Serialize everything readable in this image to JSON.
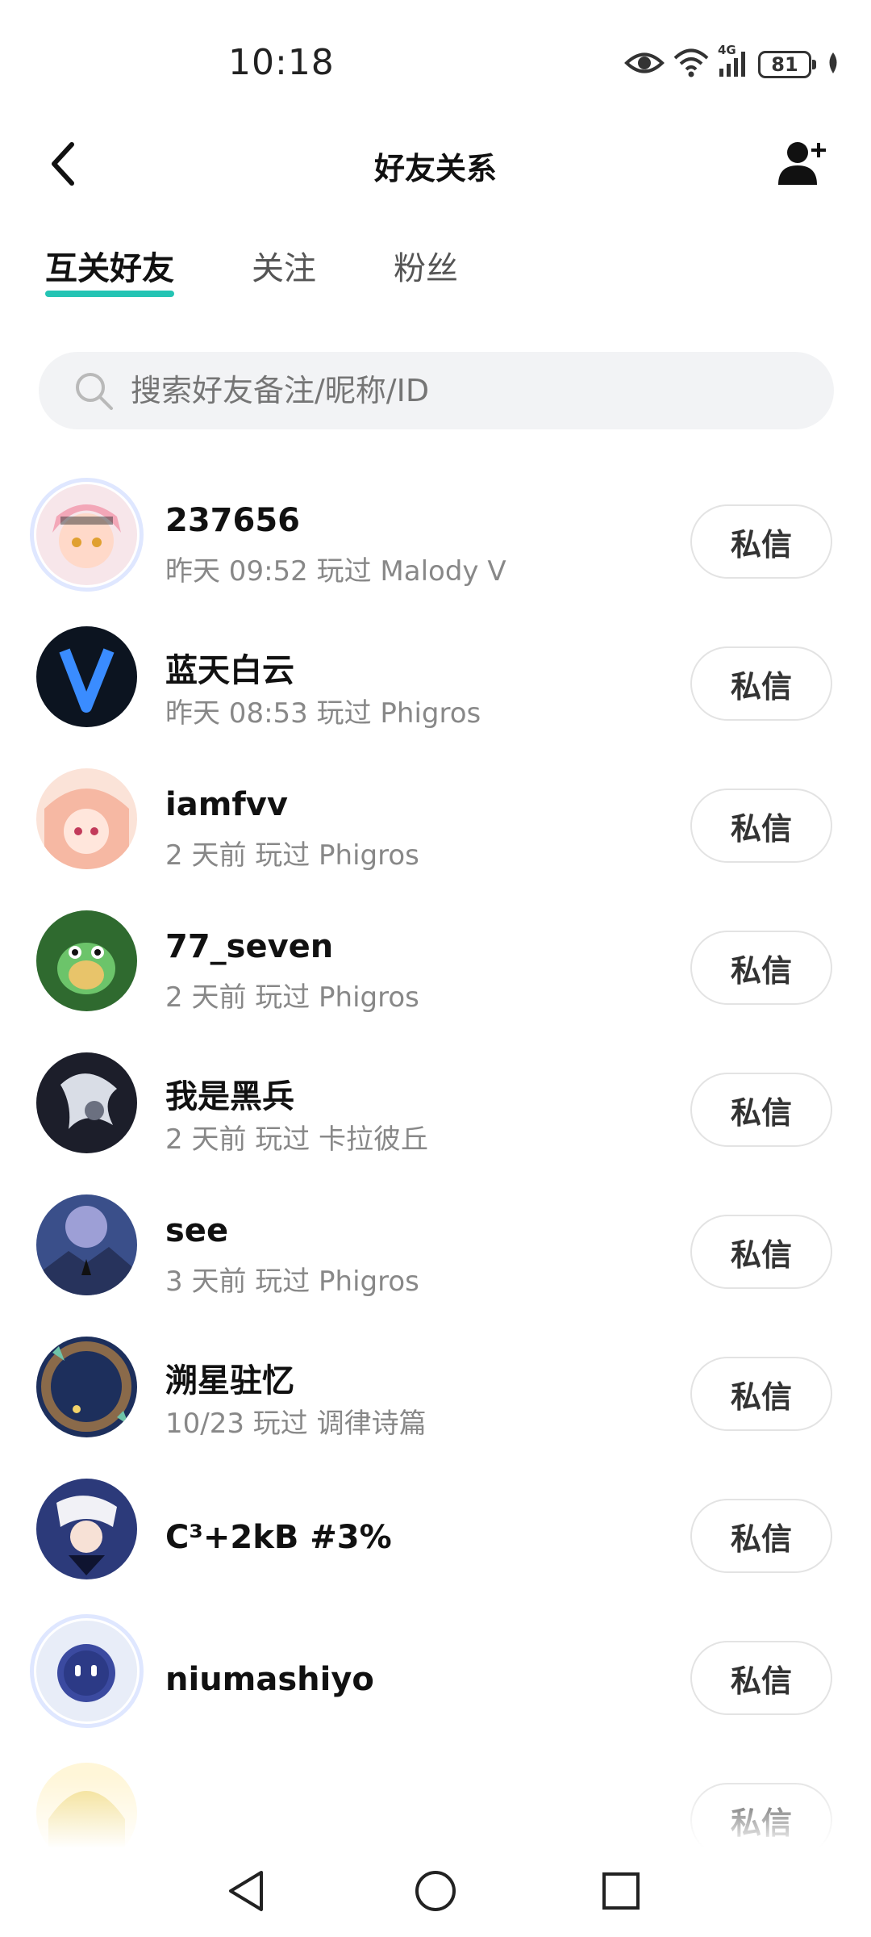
{
  "status_bar": {
    "time": "10:18",
    "network": "4G",
    "battery": "81",
    "icons": [
      "eye-icon",
      "wifi-icon",
      "signal-icon",
      "battery-icon",
      "leaf-icon"
    ]
  },
  "header": {
    "title": "好友关系",
    "back_icon": "chevron-left-icon",
    "add_icon": "add-user-icon"
  },
  "tabs": [
    {
      "label": "互关好友",
      "active": true
    },
    {
      "label": "关注",
      "active": false
    },
    {
      "label": "粉丝",
      "active": false
    }
  ],
  "search": {
    "placeholder": "搜索好友备注/昵称/ID",
    "value": ""
  },
  "friends": [
    {
      "name": "237656",
      "meta": "昨天 09:52 玩过 Malody V",
      "action": "私信"
    },
    {
      "name": "蓝天白云",
      "meta": "昨天 08:53 玩过 Phigros",
      "action": "私信"
    },
    {
      "name": "iamfvv",
      "meta": "2 天前 玩过 Phigros",
      "action": "私信"
    },
    {
      "name": "77_seven",
      "meta": "2 天前 玩过 Phigros",
      "action": "私信"
    },
    {
      "name": "我是黑兵",
      "meta": "2 天前 玩过 卡拉彼丘",
      "action": "私信"
    },
    {
      "name": "see",
      "meta": "3 天前 玩过 Phigros",
      "action": "私信"
    },
    {
      "name": "溯星驻忆",
      "meta": "10/23 玩过 调律诗篇",
      "action": "私信"
    },
    {
      "name": "C³+2kB #3%",
      "meta": "",
      "action": "私信"
    },
    {
      "name": "niumashiyo",
      "meta": "",
      "action": "私信"
    },
    {
      "name": "",
      "meta": "",
      "action": "私信"
    }
  ],
  "nav": {
    "back_icon": "triangle-back-icon",
    "home_icon": "circle-home-icon",
    "recents_icon": "square-recents-icon"
  },
  "colors": {
    "accent": "#24c4b4",
    "meta_text": "#888888",
    "search_bg": "#f2f3f5"
  }
}
